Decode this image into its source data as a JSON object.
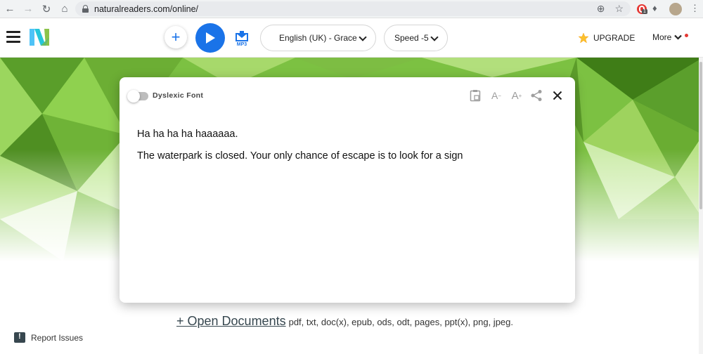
{
  "browser": {
    "url": "naturalreaders.com/online/",
    "nav_icons": [
      "back-icon",
      "forward-icon",
      "reload-icon",
      "home-icon"
    ],
    "extension_badge": "1"
  },
  "toolbar": {
    "voice": "English (UK) - Grace",
    "speed": "Speed -5",
    "upgrade": "UPGRADE",
    "more": "More",
    "accent": "#1a73e8"
  },
  "modal": {
    "dyslexic_label": "Dyslexic Font",
    "lines": [
      "Ha ha ha ha haaaaaa.",
      "The waterpark is closed. Your only chance of escape is to look for a sign"
    ]
  },
  "footer": {
    "open_docs": "+ Open Documents",
    "file_types": "pdf, txt, doc(x), epub, ods, odt, pages, ppt(x), png, jpeg.",
    "report": "Report Issues"
  }
}
